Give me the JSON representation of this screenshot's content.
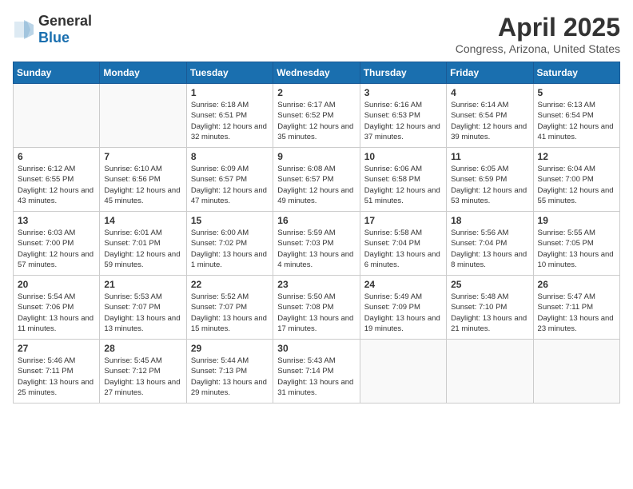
{
  "logo": {
    "general": "General",
    "blue": "Blue"
  },
  "header": {
    "month": "April 2025",
    "location": "Congress, Arizona, United States"
  },
  "weekdays": [
    "Sunday",
    "Monday",
    "Tuesday",
    "Wednesday",
    "Thursday",
    "Friday",
    "Saturday"
  ],
  "weeks": [
    [
      {
        "day": "",
        "empty": true
      },
      {
        "day": "",
        "empty": true
      },
      {
        "day": "1",
        "sunrise": "Sunrise: 6:18 AM",
        "sunset": "Sunset: 6:51 PM",
        "daylight": "Daylight: 12 hours and 32 minutes."
      },
      {
        "day": "2",
        "sunrise": "Sunrise: 6:17 AM",
        "sunset": "Sunset: 6:52 PM",
        "daylight": "Daylight: 12 hours and 35 minutes."
      },
      {
        "day": "3",
        "sunrise": "Sunrise: 6:16 AM",
        "sunset": "Sunset: 6:53 PM",
        "daylight": "Daylight: 12 hours and 37 minutes."
      },
      {
        "day": "4",
        "sunrise": "Sunrise: 6:14 AM",
        "sunset": "Sunset: 6:54 PM",
        "daylight": "Daylight: 12 hours and 39 minutes."
      },
      {
        "day": "5",
        "sunrise": "Sunrise: 6:13 AM",
        "sunset": "Sunset: 6:54 PM",
        "daylight": "Daylight: 12 hours and 41 minutes."
      }
    ],
    [
      {
        "day": "6",
        "sunrise": "Sunrise: 6:12 AM",
        "sunset": "Sunset: 6:55 PM",
        "daylight": "Daylight: 12 hours and 43 minutes."
      },
      {
        "day": "7",
        "sunrise": "Sunrise: 6:10 AM",
        "sunset": "Sunset: 6:56 PM",
        "daylight": "Daylight: 12 hours and 45 minutes."
      },
      {
        "day": "8",
        "sunrise": "Sunrise: 6:09 AM",
        "sunset": "Sunset: 6:57 PM",
        "daylight": "Daylight: 12 hours and 47 minutes."
      },
      {
        "day": "9",
        "sunrise": "Sunrise: 6:08 AM",
        "sunset": "Sunset: 6:57 PM",
        "daylight": "Daylight: 12 hours and 49 minutes."
      },
      {
        "day": "10",
        "sunrise": "Sunrise: 6:06 AM",
        "sunset": "Sunset: 6:58 PM",
        "daylight": "Daylight: 12 hours and 51 minutes."
      },
      {
        "day": "11",
        "sunrise": "Sunrise: 6:05 AM",
        "sunset": "Sunset: 6:59 PM",
        "daylight": "Daylight: 12 hours and 53 minutes."
      },
      {
        "day": "12",
        "sunrise": "Sunrise: 6:04 AM",
        "sunset": "Sunset: 7:00 PM",
        "daylight": "Daylight: 12 hours and 55 minutes."
      }
    ],
    [
      {
        "day": "13",
        "sunrise": "Sunrise: 6:03 AM",
        "sunset": "Sunset: 7:00 PM",
        "daylight": "Daylight: 12 hours and 57 minutes."
      },
      {
        "day": "14",
        "sunrise": "Sunrise: 6:01 AM",
        "sunset": "Sunset: 7:01 PM",
        "daylight": "Daylight: 12 hours and 59 minutes."
      },
      {
        "day": "15",
        "sunrise": "Sunrise: 6:00 AM",
        "sunset": "Sunset: 7:02 PM",
        "daylight": "Daylight: 13 hours and 1 minute."
      },
      {
        "day": "16",
        "sunrise": "Sunrise: 5:59 AM",
        "sunset": "Sunset: 7:03 PM",
        "daylight": "Daylight: 13 hours and 4 minutes."
      },
      {
        "day": "17",
        "sunrise": "Sunrise: 5:58 AM",
        "sunset": "Sunset: 7:04 PM",
        "daylight": "Daylight: 13 hours and 6 minutes."
      },
      {
        "day": "18",
        "sunrise": "Sunrise: 5:56 AM",
        "sunset": "Sunset: 7:04 PM",
        "daylight": "Daylight: 13 hours and 8 minutes."
      },
      {
        "day": "19",
        "sunrise": "Sunrise: 5:55 AM",
        "sunset": "Sunset: 7:05 PM",
        "daylight": "Daylight: 13 hours and 10 minutes."
      }
    ],
    [
      {
        "day": "20",
        "sunrise": "Sunrise: 5:54 AM",
        "sunset": "Sunset: 7:06 PM",
        "daylight": "Daylight: 13 hours and 11 minutes."
      },
      {
        "day": "21",
        "sunrise": "Sunrise: 5:53 AM",
        "sunset": "Sunset: 7:07 PM",
        "daylight": "Daylight: 13 hours and 13 minutes."
      },
      {
        "day": "22",
        "sunrise": "Sunrise: 5:52 AM",
        "sunset": "Sunset: 7:07 PM",
        "daylight": "Daylight: 13 hours and 15 minutes."
      },
      {
        "day": "23",
        "sunrise": "Sunrise: 5:50 AM",
        "sunset": "Sunset: 7:08 PM",
        "daylight": "Daylight: 13 hours and 17 minutes."
      },
      {
        "day": "24",
        "sunrise": "Sunrise: 5:49 AM",
        "sunset": "Sunset: 7:09 PM",
        "daylight": "Daylight: 13 hours and 19 minutes."
      },
      {
        "day": "25",
        "sunrise": "Sunrise: 5:48 AM",
        "sunset": "Sunset: 7:10 PM",
        "daylight": "Daylight: 13 hours and 21 minutes."
      },
      {
        "day": "26",
        "sunrise": "Sunrise: 5:47 AM",
        "sunset": "Sunset: 7:11 PM",
        "daylight": "Daylight: 13 hours and 23 minutes."
      }
    ],
    [
      {
        "day": "27",
        "sunrise": "Sunrise: 5:46 AM",
        "sunset": "Sunset: 7:11 PM",
        "daylight": "Daylight: 13 hours and 25 minutes."
      },
      {
        "day": "28",
        "sunrise": "Sunrise: 5:45 AM",
        "sunset": "Sunset: 7:12 PM",
        "daylight": "Daylight: 13 hours and 27 minutes."
      },
      {
        "day": "29",
        "sunrise": "Sunrise: 5:44 AM",
        "sunset": "Sunset: 7:13 PM",
        "daylight": "Daylight: 13 hours and 29 minutes."
      },
      {
        "day": "30",
        "sunrise": "Sunrise: 5:43 AM",
        "sunset": "Sunset: 7:14 PM",
        "daylight": "Daylight: 13 hours and 31 minutes."
      },
      {
        "day": "",
        "empty": true
      },
      {
        "day": "",
        "empty": true
      },
      {
        "day": "",
        "empty": true
      }
    ]
  ]
}
